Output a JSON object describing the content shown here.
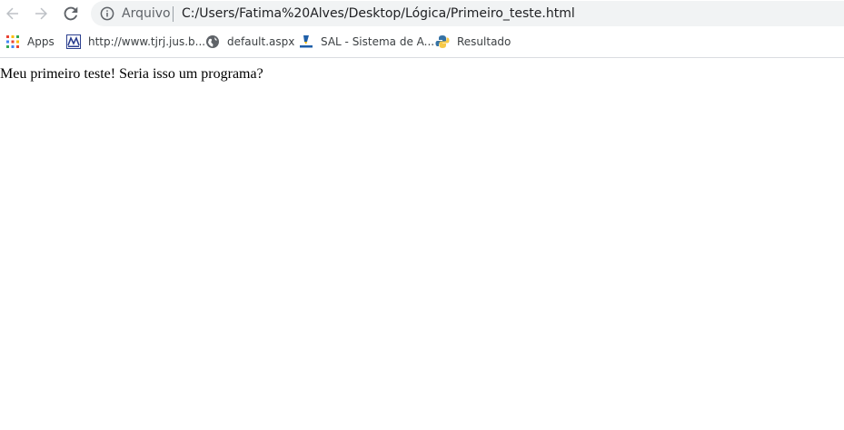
{
  "toolbar": {
    "back_icon": "arrow-left-icon",
    "forward_icon": "arrow-right-icon",
    "reload_icon": "reload-icon"
  },
  "omnibox": {
    "info_icon": "info-icon",
    "scheme_label": "Arquivo",
    "url": "C:/Users/Fatima%20Alves/Desktop/Lógica/Primeiro_teste.html"
  },
  "bookmarks": [
    {
      "label": "Apps",
      "icon": "apps-grid-icon"
    },
    {
      "label": "http://www.tjrj.jus.b...",
      "icon": "tjrj-favicon"
    },
    {
      "label": "default.aspx",
      "icon": "globe-icon"
    },
    {
      "label": "SAL - Sistema de A...",
      "icon": "sal-favicon"
    },
    {
      "label": "Resultado",
      "icon": "resultado-favicon"
    }
  ],
  "page": {
    "text": "Meu primeiro teste! Seria isso um programa?"
  },
  "colors": {
    "omnibox_bg": "#f1f3f4",
    "url_text": "#202124",
    "muted_text": "#5f6368",
    "nav_icon_disabled": "#bdc1c6",
    "nav_icon_active": "#5f6368"
  }
}
